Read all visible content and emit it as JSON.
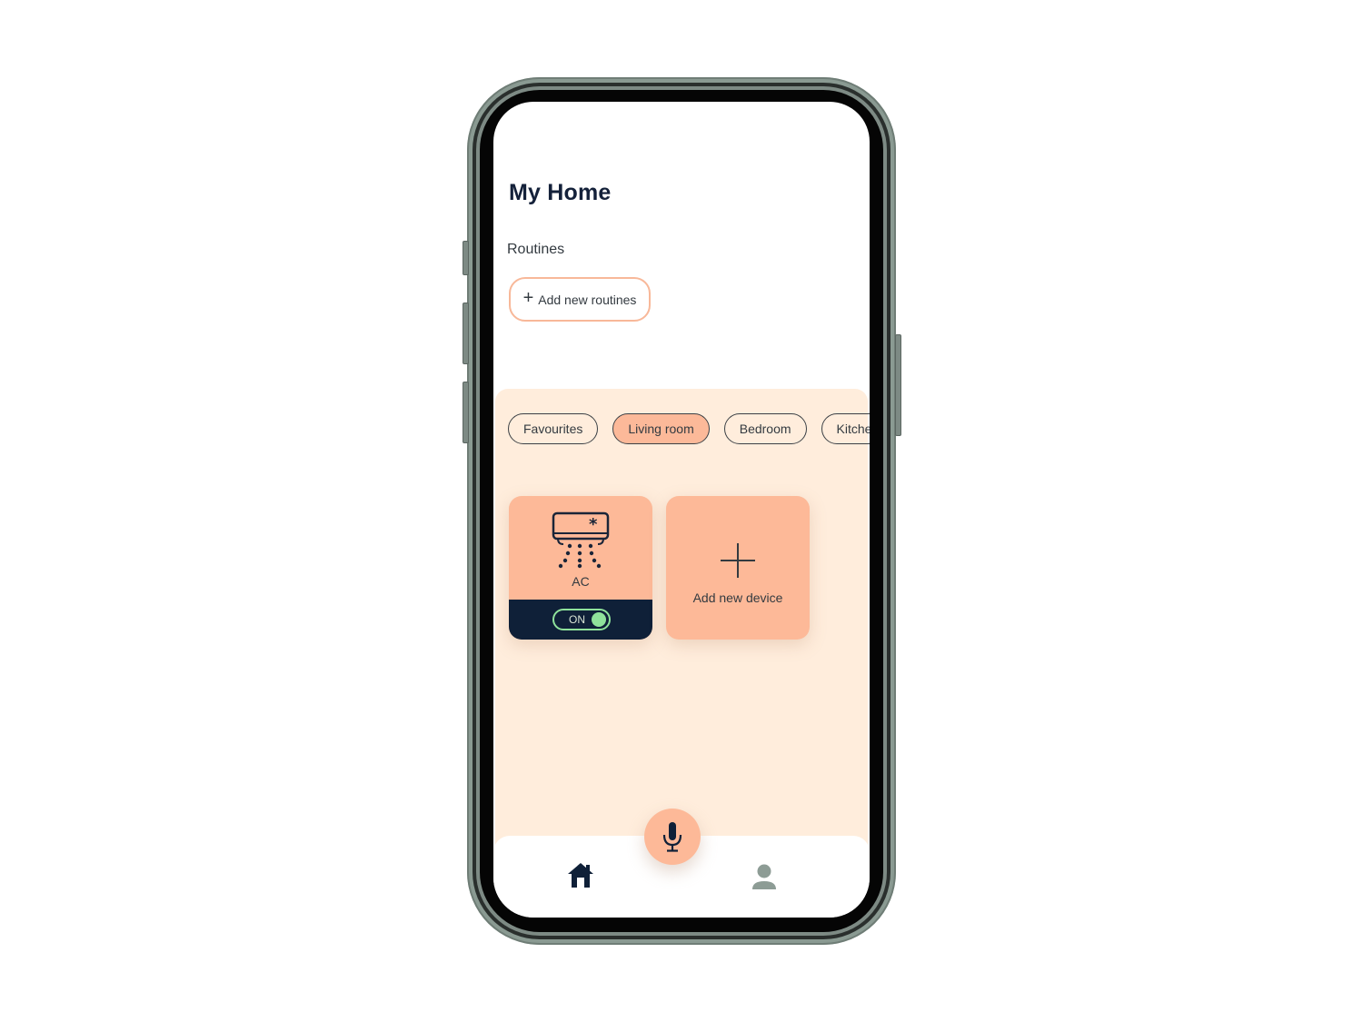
{
  "app": {
    "title": "My Home"
  },
  "routines": {
    "label": "Routines",
    "add_button": "Add new routines"
  },
  "rooms": {
    "tabs": [
      {
        "label": "Favourites",
        "active": false
      },
      {
        "label": "Living room",
        "active": true
      },
      {
        "label": "Bedroom",
        "active": false
      },
      {
        "label": "Kitche",
        "active": false
      }
    ]
  },
  "devices": [
    {
      "name": "AC",
      "icon": "air-conditioner-icon",
      "status": "ON",
      "on": true
    }
  ],
  "add_device": {
    "label": "Add new device",
    "icon": "plus-icon"
  },
  "bottom_nav": {
    "items": [
      {
        "icon": "home-icon",
        "active": true
      },
      {
        "icon": "microphone-icon"
      },
      {
        "icon": "profile-icon",
        "active": false
      }
    ]
  },
  "colors": {
    "accent": "#fdb998",
    "panel_bg": "#ffeddc",
    "dark": "#0f2038",
    "toggle_on": "#8fe29b",
    "title": "#14213a",
    "inactive_icon": "#8d9c95"
  }
}
